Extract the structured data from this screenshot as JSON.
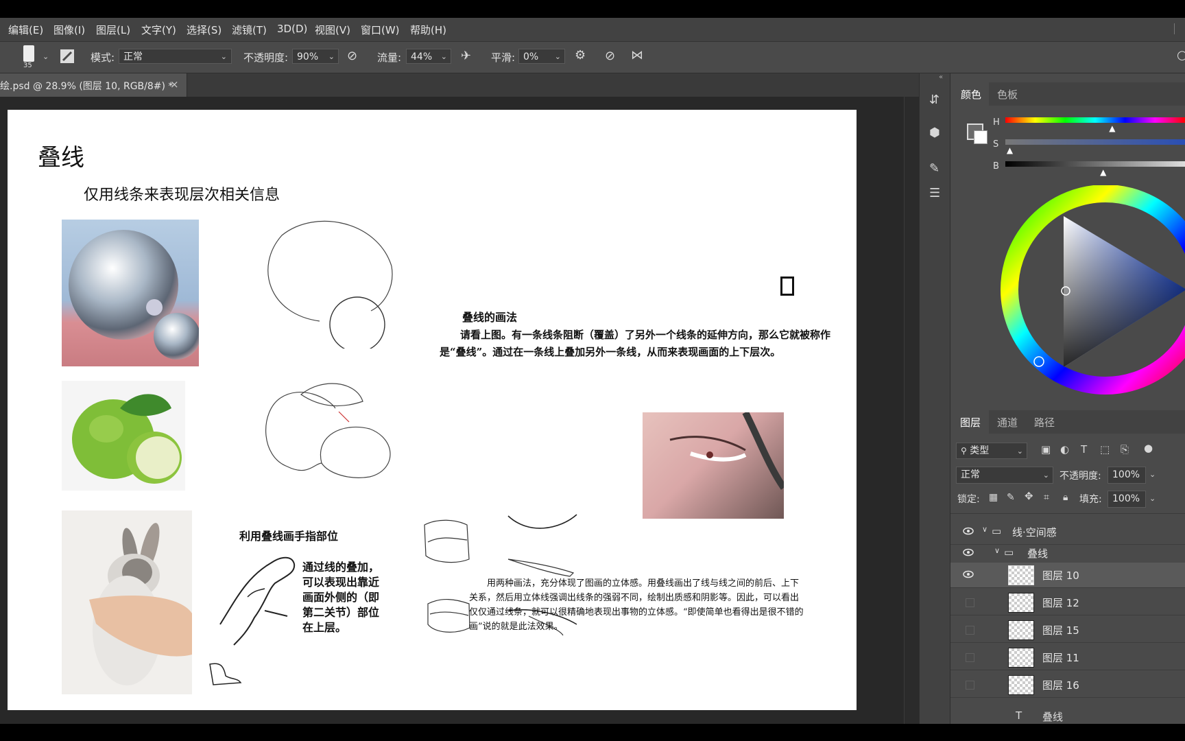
{
  "menu": [
    "编辑(E)",
    "图像(I)",
    "图层(L)",
    "文字(Y)",
    "选择(S)",
    "滤镜(T)",
    "3D(D)",
    "视图(V)",
    "窗口(W)",
    "帮助(H)"
  ],
  "options": {
    "brush_size": "35",
    "mode_label": "模式:",
    "mode_value": "正常",
    "opacity_label": "不透明度:",
    "opacity_value": "90%",
    "flow_label": "流量:",
    "flow_value": "44%",
    "smooth_label": "平滑:",
    "smooth_value": "0%"
  },
  "document_tab": {
    "title": "绘.psd @ 28.9% (图层 10, RGB/8#) *",
    "close": "×"
  },
  "canvas": {
    "heading": "叠线",
    "subheading": "仅用线条来表现层次相关信息",
    "method_title": "叠线的画法",
    "method_body": "请看上图。有一条线条阻断（覆盖）了另外一个线条的延伸方向，那么它就被称作是“叠线”。通过在一条线上叠加另外一条线，从而来表现画面的上下层次。",
    "finger_title": "利用叠线画手指部位",
    "finger_body": "通过线的叠加，可以表现出靠近画面外侧的（即第二关节）部位在上层。",
    "summary": "用两种画法，充分体现了图画的立体感。用叠线画出了线与线之间的前后、上下关系，然后用立体线强调出线条的强弱不同，绘制出质感和阴影等。因此，可以看出仅仅通过线条，就可以很精确地表现出事物的立体感。“即使简单也看得出是很不错的画”说的就是此法效果。"
  },
  "color_panel": {
    "tabs": [
      "颜色",
      "色板"
    ],
    "sliders": [
      {
        "label": "H",
        "value": 0.6
      },
      {
        "label": "S",
        "value": 0.03
      },
      {
        "label": "B",
        "value": 0.55
      }
    ]
  },
  "layers_panel": {
    "tabs": [
      "图层",
      "通道",
      "路径"
    ],
    "filter_label": "类型",
    "blend_mode": "正常",
    "opacity_label": "不透明度:",
    "opacity_value": "100%",
    "lock_label": "锁定:",
    "fill_label": "填充:",
    "fill_value": "100%",
    "groups": [
      {
        "name": "线·空间感",
        "visible": true
      },
      {
        "name": "叠线",
        "visible": true
      }
    ],
    "layers": [
      {
        "name": "图层 10",
        "visible": true,
        "selected": true
      },
      {
        "name": "图层 12",
        "visible": false,
        "selected": false
      },
      {
        "name": "图层 15",
        "visible": false,
        "selected": false
      },
      {
        "name": "图层 11",
        "visible": false,
        "selected": false
      },
      {
        "name": "图层 16",
        "visible": false,
        "selected": false
      }
    ],
    "partial_bottom": "叠线"
  },
  "colors": {
    "menu_bg": "#424242",
    "panel_bg": "#4a4a4a",
    "workspace_bg": "#282828",
    "selected_row": "#5a5a5a"
  }
}
